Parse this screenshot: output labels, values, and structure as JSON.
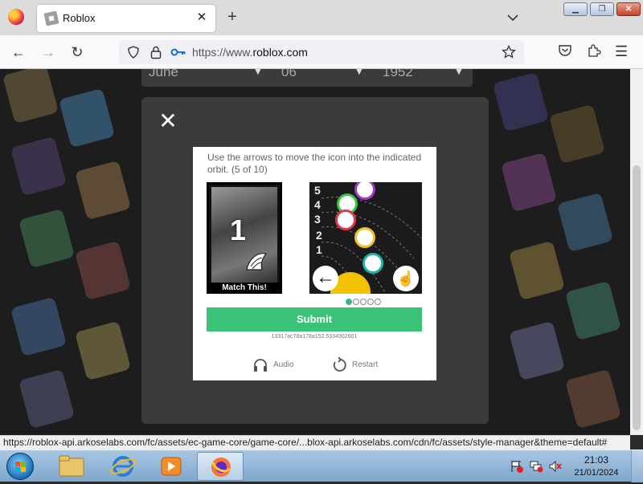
{
  "browser": {
    "tab_title": "Roblox",
    "tab_close": "✕",
    "new_tab": "+",
    "url_prefix": "https://www.",
    "url_domain": "roblox.com"
  },
  "page": {
    "date_month": "June",
    "date_day": "06",
    "date_year": "1952"
  },
  "captcha": {
    "instruction": "Use the arrows to move the icon into the indicated orbit. (5 of 10)",
    "target_number": "1",
    "match_label": "Match This!",
    "orbit_labels": [
      "5",
      "4",
      "3",
      "2",
      "1"
    ],
    "progress": {
      "current": 1,
      "total": 5
    },
    "submit_label": "Submit",
    "session_id": "13317ac78a178a152.5334902601",
    "audio_label": "Audio",
    "restart_label": "Restart",
    "colors": {
      "submit": "#3cc178",
      "progress_active": "#3fb27f"
    }
  },
  "status_url": "https://roblox-api.arkoselabs.com/fc/assets/ec-game-core/game-core/...blox-api.arkoselabs.com/cdn/fc/assets/style-manager&theme=default#",
  "taskbar": {
    "time": "21:03",
    "date": "21/01/2024"
  }
}
